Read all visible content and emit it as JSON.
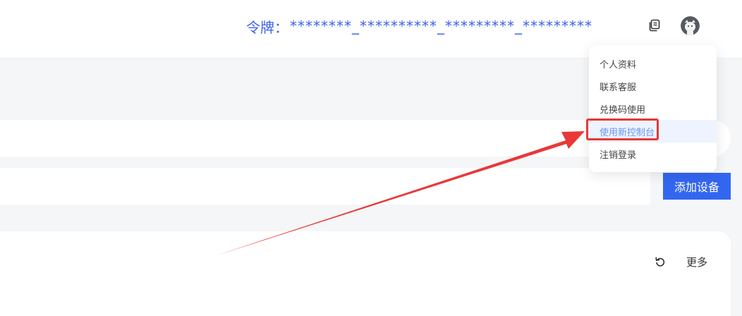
{
  "header": {
    "token_label": "令牌：",
    "token_value": "********_**********_*********_*********"
  },
  "icons": {
    "copy": "copy-icon",
    "avatar": "user-avatar",
    "refresh": "refresh-icon"
  },
  "user_menu": {
    "items": [
      {
        "label": "个人资料"
      },
      {
        "label": "联系客服"
      },
      {
        "label": "兑换码使用"
      },
      {
        "label": "使用新控制台",
        "highlighted": true
      },
      {
        "label": "注销登录"
      }
    ]
  },
  "actions": {
    "add_device": "添加设备",
    "more": "更多"
  },
  "colors": {
    "accent": "#3366f0",
    "token_text": "#3f62ea",
    "annotation": "#e93838",
    "menu_active_bg": "#edf3ff",
    "menu_active_text": "#6b95f4"
  }
}
